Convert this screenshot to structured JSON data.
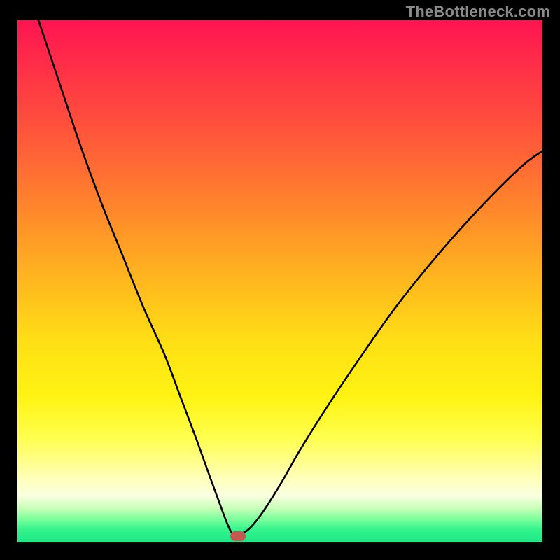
{
  "watermark": "TheBottleneck.com",
  "colors": {
    "background": "#000000",
    "gradient_top": "#ff1452",
    "gradient_mid": "#ffe015",
    "gradient_bottom": "#1de887",
    "curve": "#000000",
    "marker": "#c25a52",
    "watermark": "#8a8a8a"
  },
  "chart_data": {
    "type": "line",
    "title": "",
    "xlabel": "",
    "ylabel": "",
    "xlim": [
      0,
      100
    ],
    "ylim": [
      0,
      100
    ],
    "grid": false,
    "legend": null,
    "marker": {
      "x": 42,
      "y": 1.2
    },
    "series": [
      {
        "name": "curve",
        "x": [
          4,
          8,
          12,
          16,
          20,
          24,
          28,
          31,
          34,
          36.5,
          38.5,
          40,
          41,
          42,
          44,
          46.5,
          50,
          54,
          59,
          65,
          72,
          80,
          88,
          96,
          100
        ],
        "values": [
          100,
          88,
          76,
          65,
          55,
          45,
          36,
          28,
          20,
          13,
          7.5,
          3.5,
          1.6,
          1.5,
          2.5,
          5.5,
          11,
          18,
          26,
          35,
          45,
          55,
          64,
          72,
          75
        ]
      }
    ],
    "annotations": []
  }
}
